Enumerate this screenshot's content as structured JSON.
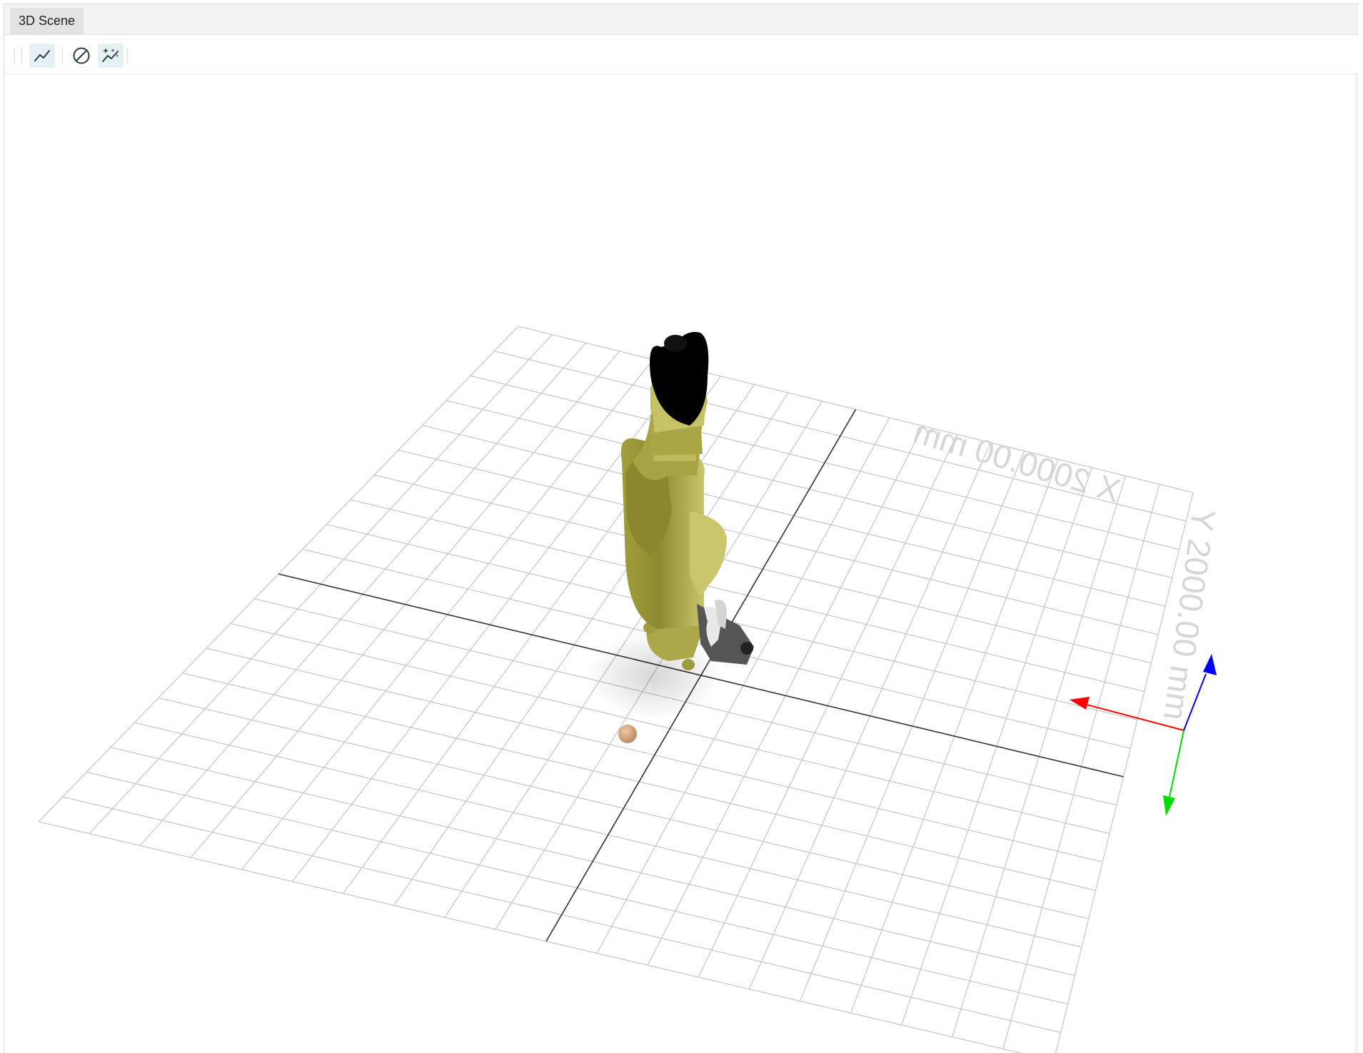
{
  "tabs": [
    {
      "label": "3D Scene",
      "active": true
    }
  ],
  "toolbar": {
    "tools": [
      {
        "name": "trajectory",
        "icon": "line-chart-icon",
        "active": true
      },
      {
        "name": "clear",
        "icon": "prohibit-icon",
        "active": false
      },
      {
        "name": "sparkle-trajectory",
        "icon": "sparkle-chart-icon",
        "active": true
      }
    ]
  },
  "scene": {
    "x_label": "X 2000.00 mm",
    "y_label": "Y 2000.00 mm",
    "grid_color": "#c8c8c8",
    "axis_color": "#333333",
    "robot_color": "#8f8c35",
    "tool_color": "#000000",
    "triad": {
      "x_color": "#ff0000",
      "y_color": "#00dd00",
      "z_color": "#0000ff"
    },
    "target_marker_color": "#d8ab85"
  }
}
